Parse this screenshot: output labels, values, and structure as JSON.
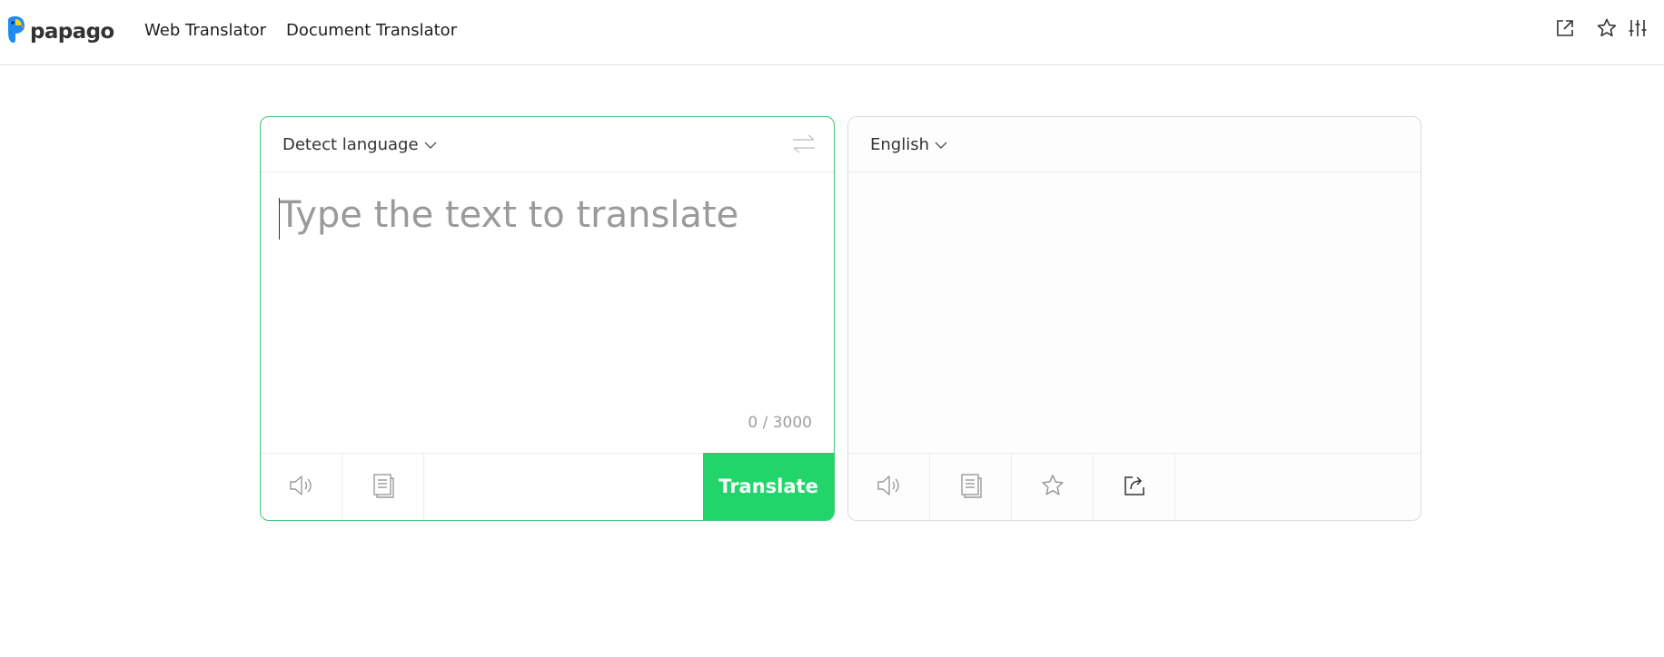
{
  "header": {
    "logo_text": "papago",
    "nav": [
      {
        "label": "Web Translator"
      },
      {
        "label": "Document Translator"
      }
    ],
    "tools": [
      "external-link-icon",
      "star-icon",
      "settings-sliders-icon"
    ]
  },
  "source": {
    "language": "Detect language",
    "placeholder": "Type the text to translate",
    "counter": "0 / 3000",
    "translate_label": "Translate",
    "actions": [
      "speaker-icon",
      "copy-icon"
    ]
  },
  "target": {
    "language": "English",
    "actions": [
      "speaker-icon",
      "copy-icon",
      "star-icon",
      "share-icon"
    ]
  },
  "colors": {
    "accent": "#22d56b",
    "source_border": "#3ec475",
    "brand_blue": "#1c8cf0",
    "brand_yellow": "#f5d020"
  }
}
